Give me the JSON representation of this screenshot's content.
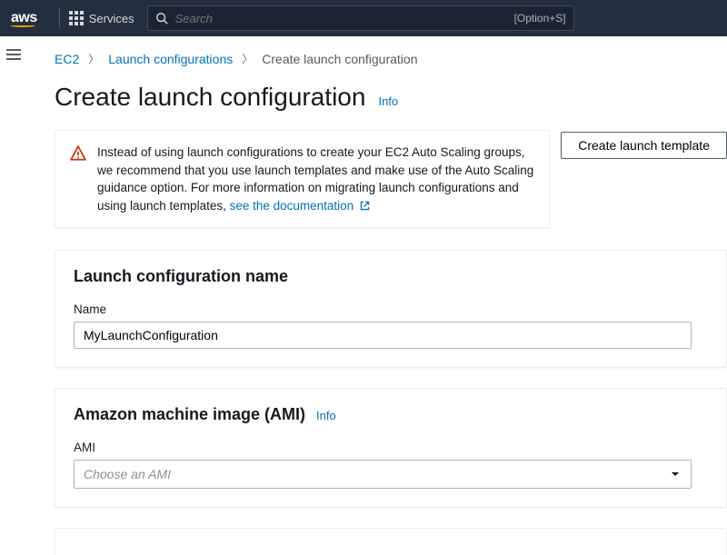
{
  "nav": {
    "logo_text": "aws",
    "services_label": "Services",
    "search_placeholder": "Search",
    "search_shortcut": "[Option+S]"
  },
  "breadcrumb": {
    "item1": "EC2",
    "item2": "Launch configurations",
    "current": "Create launch configuration"
  },
  "page": {
    "title": "Create launch configuration",
    "info_label": "Info"
  },
  "warning": {
    "text_part1": "Instead of using launch configurations to create your EC2 Auto Scaling groups, we recommend that you use launch templates and make use of the Auto Scaling guidance option. For more information on migrating launch configurations and using launch templates, ",
    "doc_link": "see the documentation",
    "button_label": "Create launch template"
  },
  "panel_name": {
    "heading": "Launch configuration name",
    "label": "Name",
    "value": "MyLaunchConfiguration"
  },
  "panel_ami": {
    "heading": "Amazon machine image (AMI)",
    "info_label": "Info",
    "label": "AMI",
    "placeholder": "Choose an AMI"
  }
}
